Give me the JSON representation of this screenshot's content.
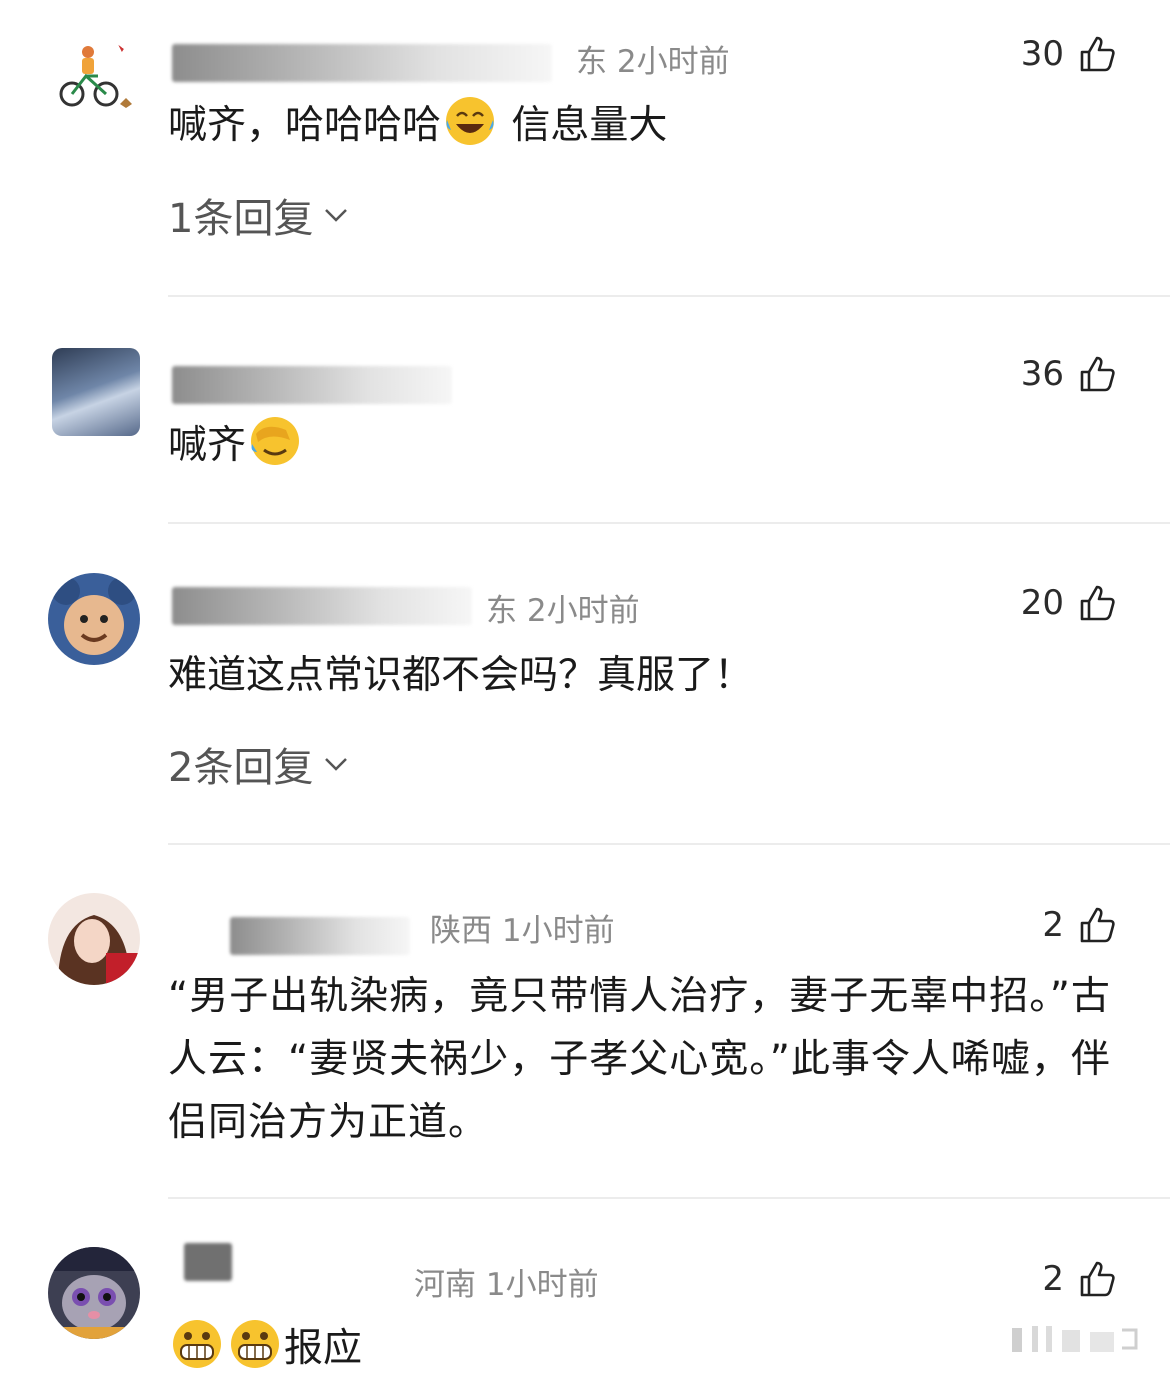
{
  "comments": [
    {
      "location_time": "东 2小时前",
      "likes": "30",
      "text_a": "喊齐，哈哈哈哈",
      "emoji_a": "laugh-cry-emoji",
      "text_b": " 信息量大",
      "replies": "1条回复"
    },
    {
      "location_time": "",
      "likes": "36",
      "text_a": "喊齐",
      "emoji_a": "facepalm-emoji"
    },
    {
      "location_time": "东 2小时前",
      "likes": "20",
      "text_a": "难道这点常识都不会吗？真服了！",
      "replies": "2条回复"
    },
    {
      "location_time": "陕西 1小时前",
      "likes": "2",
      "text_a": "“男子出轨染病，竟只带情人治疗，妻子无辜中招。”古人云：“妻贤夫祸少，子孝父心宽。”此事令人唏嘘，伴侣同治方为正道。"
    },
    {
      "location_time": "河南 1小时前",
      "likes": "2",
      "emoji_a": "grin-emoji",
      "emoji_b": "grin-emoji",
      "text_a": "报应"
    }
  ],
  "icons": {
    "like": "thumbs-up-icon",
    "expand": "chevron-down-icon"
  },
  "colors": {
    "meta": "#8a8a8a",
    "divider": "#ececec",
    "emoji": "#f7c32e"
  }
}
